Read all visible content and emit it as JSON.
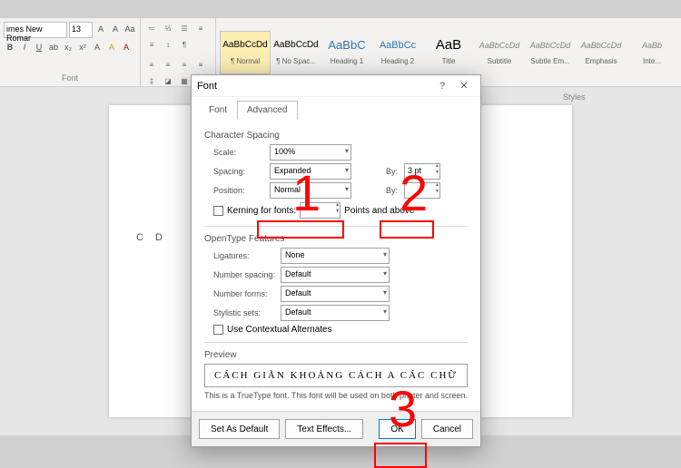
{
  "ribbon": {
    "font_name": "imes New Romar",
    "font_size": "13",
    "group_font": "Font",
    "group_styles": "Styles",
    "styles": [
      {
        "preview": "AaBbCcDd",
        "name": "¶ Normal"
      },
      {
        "preview": "AaBbCcDd",
        "name": "¶ No Spac..."
      },
      {
        "preview": "AaBbC",
        "name": "Heading 1"
      },
      {
        "preview": "AaBbCc",
        "name": "Heading 2"
      },
      {
        "preview": "AaB",
        "name": "Title"
      },
      {
        "preview": "AaBbCcDd",
        "name": "Subtitle"
      },
      {
        "preview": "AaBbCcDd",
        "name": "Subtle Em..."
      },
      {
        "preview": "AaBbCcDd",
        "name": "Emphasis"
      },
      {
        "preview": "AaBb",
        "name": "Inte..."
      }
    ]
  },
  "doc": {
    "bg_text": "C                                                              D"
  },
  "dialog": {
    "title": "Font",
    "help": "?",
    "close": "✕",
    "tabs": {
      "font": "Font",
      "advanced": "Advanced"
    },
    "char_spacing": {
      "title": "Character Spacing",
      "scale_label": "Scale:",
      "scale_value": "100%",
      "spacing_label": "Spacing:",
      "spacing_value": "Expanded",
      "by1_label": "By:",
      "by1_value": "3 pt",
      "position_label": "Position:",
      "position_value": "Normal",
      "by2_label": "By:",
      "by2_value": "",
      "kerning_label": "Kerning for fonts:",
      "kerning_after": "Points and above"
    },
    "opentype": {
      "title": "OpenType Features",
      "ligatures_label": "Ligatures:",
      "ligatures_value": "None",
      "numspacing_label": "Number spacing:",
      "numspacing_value": "Default",
      "numforms_label": "Number forms:",
      "numforms_value": "Default",
      "stylistic_label": "Stylistic sets:",
      "stylistic_value": "Default",
      "contextual_label": "Use Contextual Alternates"
    },
    "preview": {
      "title": "Preview",
      "text": "CÁCH GIÃN KHOẢNG CÁCH      A CÁC CHỮ",
      "note": "This is a TrueType font. This font will be used on both printer and screen."
    },
    "buttons": {
      "set_default": "Set As Default",
      "text_effects": "Text Effects...",
      "ok": "OK",
      "cancel": "Cancel"
    }
  },
  "annotations": {
    "n1": "1",
    "n2": "2",
    "n3": "3"
  }
}
